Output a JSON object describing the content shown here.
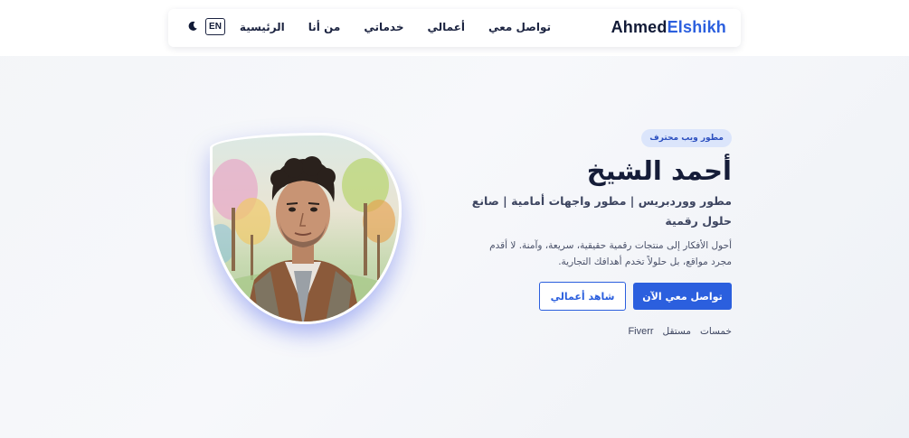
{
  "brand": {
    "part1": "Ahmed",
    "part2": "Elshikh"
  },
  "nav": {
    "items": [
      {
        "label": "الرئيسية"
      },
      {
        "label": "من أنا"
      },
      {
        "label": "خدماتي"
      },
      {
        "label": "أعمالي"
      },
      {
        "label": "تواصل معي"
      }
    ],
    "lang_label": "EN",
    "theme_icon": "moon-icon"
  },
  "hero": {
    "badge": "مطور ويب محترف",
    "name": "أحمد الشيخ",
    "role": "مطور ووردبريس | مطور واجهات أمامية | صانع حلول رقمية",
    "description": "أحول الأفكار إلى منتجات رقمية حقيقية، سريعة، وآمنة. لا أقدم مجرد مواقع، بل حلولاً تخدم أهدافك التجارية.",
    "primary_button": "تواصل معي الآن",
    "secondary_button": "شاهد أعمالي",
    "platforms": [
      "خمسات",
      "مستقل",
      "Fiverr"
    ]
  },
  "colors": {
    "accent": "#2b5fde",
    "dark": "#111a36",
    "badge_bg": "#dbe5fb"
  }
}
